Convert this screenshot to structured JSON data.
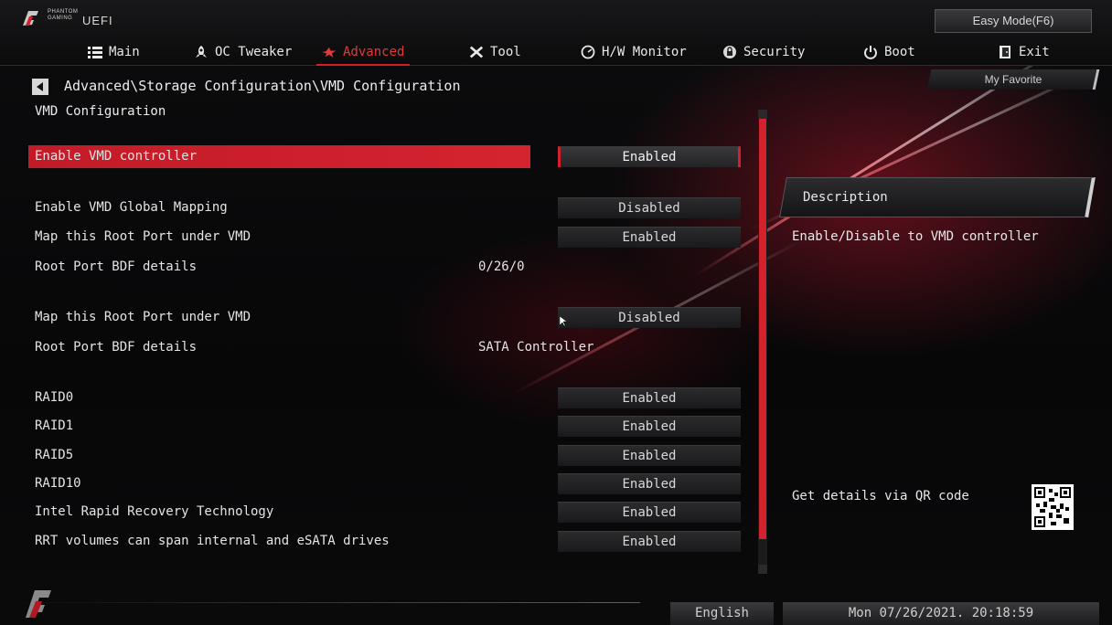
{
  "brand": {
    "small_line1": "PHANTOM",
    "small_line2": "GAMING",
    "uefi": "UEFI"
  },
  "top": {
    "easy_mode": "Easy Mode(F6)",
    "my_favorite": "My Favorite"
  },
  "nav": {
    "items": [
      {
        "label": "Main",
        "icon": "list-icon"
      },
      {
        "label": "OC Tweaker",
        "icon": "rocket-icon"
      },
      {
        "label": "Advanced",
        "icon": "star-icon",
        "active": true
      },
      {
        "label": "Tool",
        "icon": "tools-icon"
      },
      {
        "label": "H/W Monitor",
        "icon": "monitor-icon"
      },
      {
        "label": "Security",
        "icon": "shield-icon"
      },
      {
        "label": "Boot",
        "icon": "power-icon"
      },
      {
        "label": "Exit",
        "icon": "exit-icon"
      }
    ]
  },
  "breadcrumb": "Advanced\\Storage Configuration\\VMD Configuration",
  "section_title": "VMD Configuration",
  "settings": [
    {
      "label": "Enable VMD controller",
      "value": "Enabled",
      "selected": true
    },
    {
      "label": "Enable VMD Global Mapping",
      "value": "Disabled"
    },
    {
      "label": "Map this Root Port under VMD",
      "value": "Enabled"
    },
    {
      "label": "Root Port BDF details",
      "static_value": "0/26/0"
    },
    {
      "label": "Map this Root Port under VMD",
      "value": "Disabled"
    },
    {
      "label": "Root Port BDF details",
      "static_value": "SATA Controller"
    },
    {
      "label": "RAID0",
      "value": "Enabled"
    },
    {
      "label": "RAID1",
      "value": "Enabled"
    },
    {
      "label": "RAID5",
      "value": "Enabled"
    },
    {
      "label": "RAID10",
      "value": "Enabled"
    },
    {
      "label": "Intel Rapid Recovery Technology",
      "value": "Enabled"
    },
    {
      "label": "RRT volumes can span internal and eSATA drives",
      "value": "Enabled"
    }
  ],
  "description": {
    "title": "Description",
    "text": "Enable/Disable to VMD controller"
  },
  "qr_label": "Get details via QR code",
  "footer": {
    "language": "English",
    "datetime": "Mon 07/26/2021. 20:18:59"
  },
  "colors": {
    "accent": "#d2202c",
    "background": "#070708"
  }
}
